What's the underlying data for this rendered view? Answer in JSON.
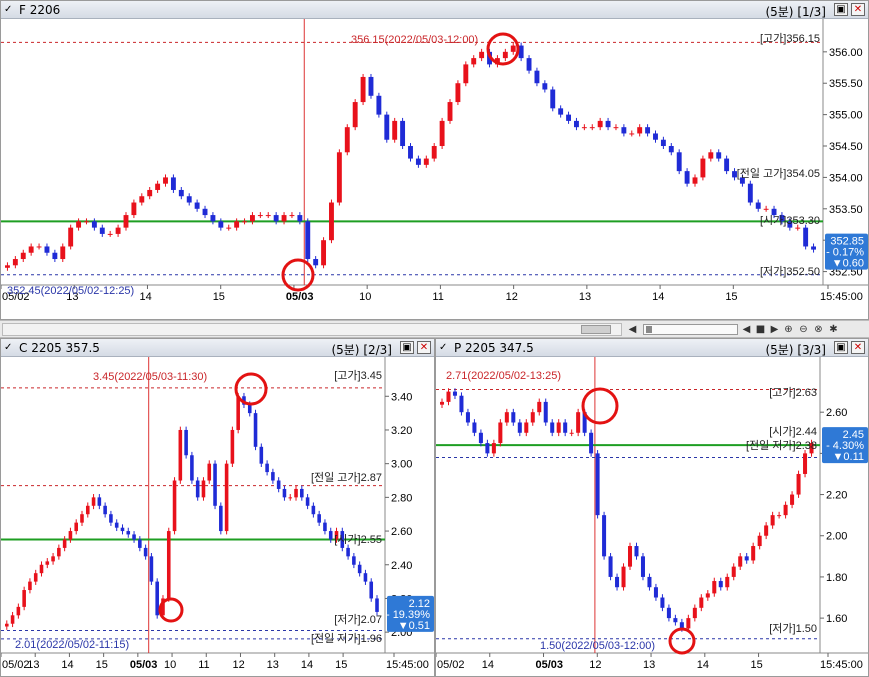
{
  "colors": {
    "up": "#e8111b",
    "down": "#1f2bd6",
    "open_line": "#1e9e22",
    "high_ref": "#c9262a",
    "low_ref": "#2a36a8",
    "badge": "#2f79d6"
  },
  "panels": {
    "top": {
      "title": "F 2206",
      "period": "(5분)",
      "index": "[1/3]",
      "high_annotation": "356.15(2022/05/03-12:00)",
      "low_annotation": "352.45(2022/05/02-12:25)",
      "ref_labels": [
        "[고가]356.15",
        "[전일 고가]354.05",
        "[시가]353.30",
        "[저가]352.50"
      ],
      "badge": [
        "352.85",
        "- 0.17%",
        "▼0.60"
      ],
      "y_ticks": [
        "356.00",
        "355.50",
        "355.00",
        "354.50",
        "354.00",
        "353.50",
        "353.00",
        "352.50"
      ],
      "x_ticks": [
        "05/02",
        "13",
        "14",
        "15",
        "05/03",
        "10",
        "11",
        "12",
        "13",
        "14",
        "15",
        "15:45:00"
      ],
      "icons": [
        "check-icon",
        "window-mode-icon",
        "close-icon"
      ]
    },
    "left": {
      "title": "C 2205 357.5",
      "period": "(5분)",
      "index": "[2/3]",
      "high_annotation": "3.45(2022/05/03-11:30)",
      "low_annotation": "2.01(2022/05/02-11:15)",
      "ref_labels": [
        "[고가]3.45",
        "[전일 고가]2.87",
        "[시가]2.55",
        "[저가]2.07",
        "[전일 저가]1.96"
      ],
      "badge": [
        "2.12",
        "- 19.39%",
        "▼0.51"
      ],
      "y_ticks": [
        "3.40",
        "3.20",
        "3.00",
        "2.80",
        "2.60",
        "2.40",
        "2.20",
        "2.00"
      ],
      "x_ticks": [
        "05/02",
        "13",
        "14",
        "15",
        "05/03",
        "10",
        "11",
        "12",
        "13",
        "14",
        "15",
        "15:45:00"
      ]
    },
    "right": {
      "title": "P 2205 347.5",
      "period": "(5분)",
      "index": "[3/3]",
      "high_annotation": "2.71(2022/05/02-13:25)",
      "low_annotation": "1.50(2022/05/03-12:00)",
      "ref_labels": [
        "[고가]2.63",
        "[시가]2.44",
        "[전일 저가]2.38",
        "[저가]1.50"
      ],
      "badge": [
        "2.45",
        "- 4.30%",
        "▼0.11"
      ],
      "y_ticks": [
        "2.60",
        "2.40",
        "2.20",
        "2.00",
        "1.80",
        "1.60"
      ],
      "x_ticks": [
        "05/02",
        "14",
        "05/03",
        "12",
        "13",
        "14",
        "15",
        "15:45:00"
      ]
    }
  },
  "chart_data": [
    {
      "type": "candlestick",
      "title": "F 2206",
      "ylim": [
        352.35,
        356.3
      ],
      "open": 353.3,
      "high": 356.15,
      "low": 352.45,
      "last": 352.85,
      "close_series": [
        352.6,
        352.7,
        352.8,
        352.9,
        352.9,
        352.8,
        352.7,
        352.9,
        353.2,
        353.3,
        353.3,
        353.2,
        353.1,
        353.1,
        353.2,
        353.4,
        353.6,
        353.7,
        353.8,
        353.9,
        354.0,
        353.8,
        353.7,
        353.6,
        353.5,
        353.4,
        353.3,
        353.2,
        353.2,
        353.3,
        353.3,
        353.4,
        353.4,
        353.4,
        353.3,
        353.4,
        353.4,
        353.3,
        352.7,
        352.6,
        353.0,
        353.6,
        354.4,
        354.8,
        355.2,
        355.6,
        355.3,
        355.0,
        354.6,
        354.9,
        354.5,
        354.3,
        354.2,
        354.3,
        354.5,
        354.9,
        355.2,
        355.5,
        355.8,
        355.9,
        356.0,
        355.8,
        355.9,
        356.0,
        356.1,
        355.9,
        355.7,
        355.5,
        355.4,
        355.1,
        355.0,
        354.9,
        354.8,
        354.8,
        354.8,
        354.9,
        354.8,
        354.8,
        354.7,
        354.7,
        354.8,
        354.7,
        354.6,
        354.5,
        354.4,
        354.1,
        353.9,
        354.0,
        354.3,
        354.4,
        354.3,
        354.1,
        354.0,
        353.9,
        353.6,
        353.5,
        353.5,
        353.4,
        353.3,
        353.2,
        353.2,
        352.9,
        352.85
      ]
    },
    {
      "type": "candlestick",
      "title": "C 2205 357.5",
      "ylim": [
        1.9,
        3.55
      ],
      "open": 2.55,
      "high": 3.45,
      "low": 2.01,
      "last": 2.12,
      "close_series": [
        2.05,
        2.1,
        2.15,
        2.25,
        2.3,
        2.35,
        2.4,
        2.42,
        2.45,
        2.5,
        2.55,
        2.6,
        2.65,
        2.7,
        2.75,
        2.8,
        2.75,
        2.7,
        2.65,
        2.62,
        2.6,
        2.58,
        2.55,
        2.5,
        2.45,
        2.3,
        2.1,
        2.2,
        2.6,
        2.9,
        3.2,
        3.05,
        2.9,
        2.8,
        2.9,
        3.0,
        2.75,
        2.6,
        3.0,
        3.2,
        3.4,
        3.35,
        3.3,
        3.1,
        3.0,
        2.95,
        2.9,
        2.85,
        2.8,
        2.8,
        2.85,
        2.8,
        2.75,
        2.7,
        2.65,
        2.6,
        2.55,
        2.6,
        2.5,
        2.45,
        2.4,
        2.35,
        2.3,
        2.2,
        2.12
      ]
    },
    {
      "type": "candlestick",
      "title": "P 2205 347.5",
      "ylim": [
        1.45,
        2.8
      ],
      "open": 2.44,
      "high": 2.71,
      "low": 1.5,
      "last": 2.45,
      "close_series": [
        2.65,
        2.7,
        2.68,
        2.6,
        2.55,
        2.5,
        2.45,
        2.4,
        2.45,
        2.55,
        2.6,
        2.55,
        2.5,
        2.55,
        2.6,
        2.65,
        2.55,
        2.5,
        2.55,
        2.5,
        2.5,
        2.6,
        2.5,
        2.4,
        2.1,
        1.9,
        1.8,
        1.75,
        1.85,
        1.95,
        1.9,
        1.8,
        1.75,
        1.7,
        1.65,
        1.6,
        1.58,
        1.55,
        1.6,
        1.65,
        1.7,
        1.72,
        1.78,
        1.75,
        1.8,
        1.85,
        1.9,
        1.88,
        1.95,
        2.0,
        2.05,
        2.1,
        2.1,
        2.15,
        2.2,
        2.3,
        2.4,
        2.45
      ]
    }
  ]
}
